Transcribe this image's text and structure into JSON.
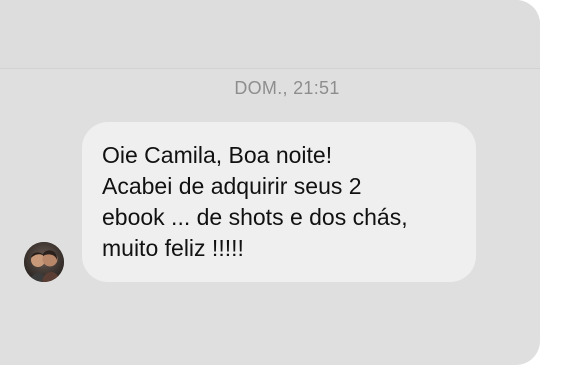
{
  "conversation": {
    "timestamp": "DOM., 21:51",
    "messages": [
      {
        "sender": "other",
        "avatar_icon": "user-avatar",
        "text": "Oie Camila, Boa noite!\nAcabei de adquirir seus 2\nebook ... de shots e dos chás,\nmuito feliz !!!!!"
      }
    ]
  },
  "colors": {
    "background": "#dfdfdf",
    "bubble": "#efefef",
    "timestamp": "#8e8e8e",
    "text": "#111111"
  }
}
